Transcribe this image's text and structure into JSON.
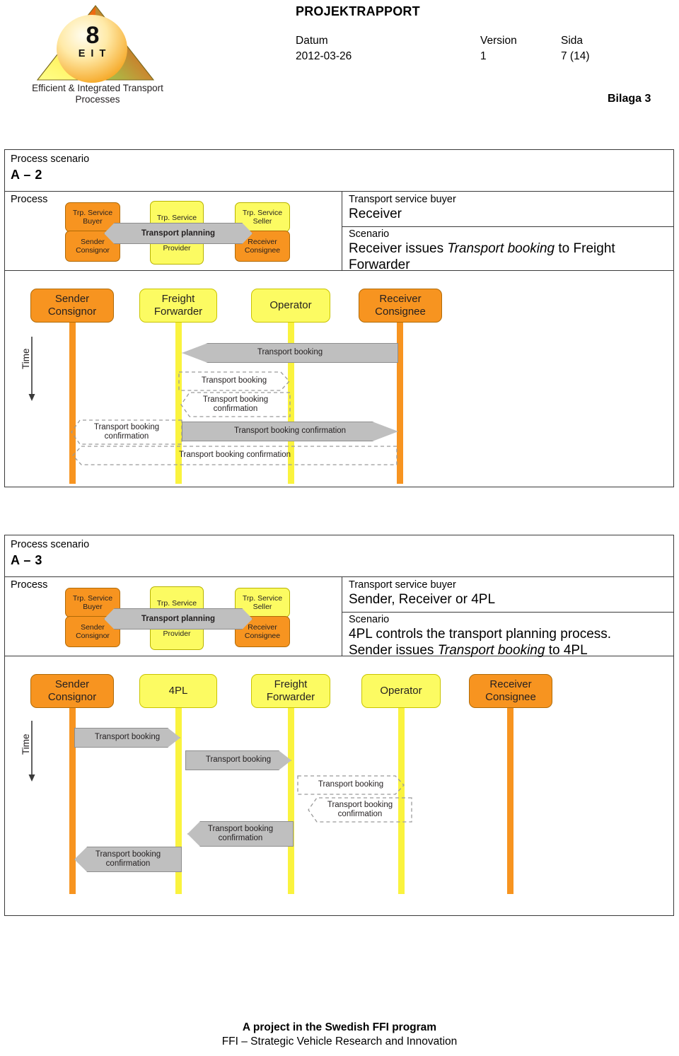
{
  "header": {
    "logo": {
      "number": "8",
      "acronym": "E I T",
      "caption_line1": "Efficient & Integrated Transport",
      "caption_line2": "Processes"
    },
    "doc_title": "PROJEKTRAPPORT",
    "meta": {
      "datum_label": "Datum",
      "datum_value": "2012-03-26",
      "version_label": "Version",
      "version_value": "1",
      "sida_label": "Sida",
      "sida_value": "7 (14)"
    },
    "appendix": "Bilaga 3"
  },
  "scenarios": [
    {
      "scenario_label": "Process scenario",
      "scenario_id": "A – 2",
      "process_label": "Process",
      "buyer_label": "Transport service buyer",
      "buyer_value": "Receiver",
      "scenario_title": "Scenario",
      "scenario_text_pre": "Receiver issues ",
      "scenario_text_italic": "Transport booking",
      "scenario_text_post": " to Freight Forwarder",
      "mini_diagram": {
        "left_top": "Trp. Service\nBuyer",
        "left_bottom": "Sender\nConsignor",
        "mid_top": "Trp. Service",
        "mid_bottom": "Provider",
        "right_top": "Trp. Service\nSeller",
        "right_bottom": "Receiver\nConsignee",
        "arrow_label": "Transport planning"
      },
      "time_label": "Time",
      "actors": [
        {
          "name": "Sender\nConsignor",
          "color": "orange"
        },
        {
          "name": "Freight\nForwarder",
          "color": "yellow"
        },
        {
          "name": "Operator",
          "color": "yellow"
        },
        {
          "name": "Receiver\nConsignee",
          "color": "orange"
        }
      ],
      "messages": [
        {
          "label": "Transport booking",
          "style": "solid",
          "direction": "left",
          "from": 3,
          "to": 1
        },
        {
          "label": "Transport booking",
          "style": "dash",
          "direction": "right",
          "from": 1,
          "to": 2
        },
        {
          "label": "Transport booking\nconfirmation",
          "style": "dash",
          "direction": "left",
          "from": 2,
          "to": 1
        },
        {
          "label": "Transport booking\nconfirmation",
          "style": "dash",
          "direction": "left",
          "from": 1,
          "to": 0
        },
        {
          "label": "Transport booking confirmation",
          "style": "solid",
          "direction": "right",
          "from": 1,
          "to": 3
        },
        {
          "label": "Transport booking confirmation",
          "style": "dash",
          "direction": "left",
          "from": 3,
          "to": 0
        }
      ]
    },
    {
      "scenario_label": "Process scenario",
      "scenario_id": "A – 3",
      "process_label": "Process",
      "buyer_label": "Transport service buyer",
      "buyer_value": "Sender, Receiver or 4PL",
      "scenario_title": "Scenario",
      "scenario_text_pre": "4PL controls the transport planning process.\nSender issues ",
      "scenario_text_italic": "Transport booking",
      "scenario_text_post": " to 4PL",
      "mini_diagram": {
        "left_top": "Trp. Service\nBuyer",
        "left_bottom": "Sender\nConsignor",
        "mid_top": "Trp. Service",
        "mid_bottom": "Provider",
        "right_top": "Trp. Service\nSeller",
        "right_bottom": "Receiver\nConsignee",
        "arrow_label": "Transport planning"
      },
      "time_label": "Time",
      "actors": [
        {
          "name": "Sender\nConsignor",
          "color": "orange"
        },
        {
          "name": "4PL",
          "color": "yellow"
        },
        {
          "name": "Freight\nForwarder",
          "color": "yellow"
        },
        {
          "name": "Operator",
          "color": "yellow"
        },
        {
          "name": "Receiver\nConsignee",
          "color": "orange"
        }
      ],
      "messages": [
        {
          "label": "Transport booking",
          "style": "solid",
          "direction": "right",
          "from": 0,
          "to": 1
        },
        {
          "label": "Transport booking",
          "style": "solid",
          "direction": "right",
          "from": 1,
          "to": 2
        },
        {
          "label": "Transport booking",
          "style": "dash",
          "direction": "right",
          "from": 2,
          "to": 3
        },
        {
          "label": "Transport booking\nconfirmation",
          "style": "dash",
          "direction": "left",
          "from": 3,
          "to": 2
        },
        {
          "label": "Transport booking\nconfirmation",
          "style": "solid",
          "direction": "left",
          "from": 2,
          "to": 1
        },
        {
          "label": "Transport booking\nconfirmation",
          "style": "solid",
          "direction": "left",
          "from": 1,
          "to": 0
        }
      ]
    }
  ],
  "footer": {
    "line1": "A project in the Swedish FFI program",
    "line2": "FFI – Strategic Vehicle Research and Innovation"
  },
  "colors": {
    "orange": "#F79420",
    "yellow": "#FCFB62",
    "lifeline_yellow": "#FAF33E",
    "message_gray": "#BFBFBF",
    "border_gray": "#3a3a3a"
  }
}
